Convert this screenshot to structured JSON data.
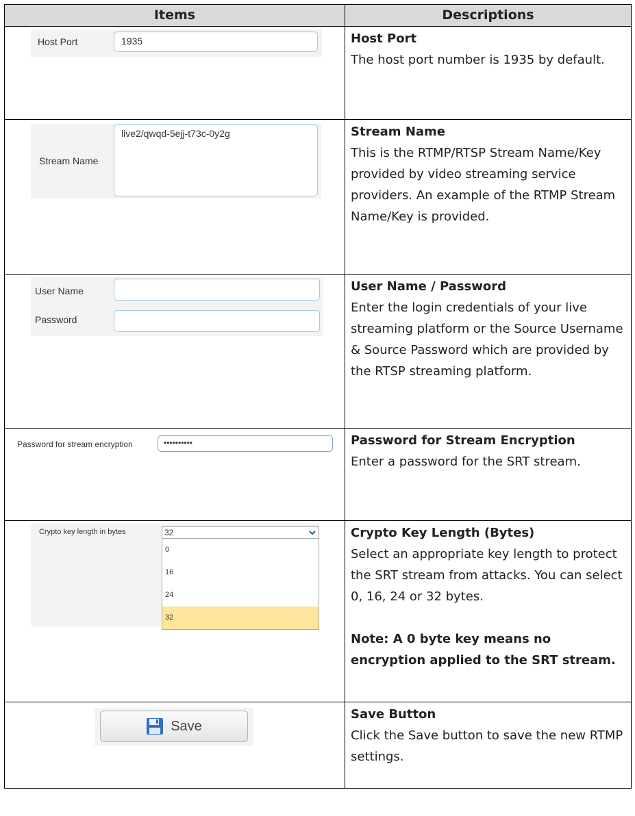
{
  "header": {
    "items": "Items",
    "descriptions": "Descriptions"
  },
  "rows": {
    "host_port": {
      "label": "Host Port",
      "value": "1935",
      "title": "Host Port",
      "desc": "The host port number is 1935 by default."
    },
    "stream_name": {
      "label": "Stream Name",
      "value": "live2/qwqd-5ejj-t73c-0y2g",
      "title": "Stream Name",
      "desc": "This is the RTMP/RTSP Stream Name/Key provided by video streaming service providers. An example of the RTMP Stream Name/Key is provided."
    },
    "credentials": {
      "user_label": "User Name",
      "user_value": "",
      "pass_label": "Password",
      "pass_value": "",
      "title": "User Name / Password",
      "desc": "Enter the login credentials of your live streaming platform or the Source Username & Source Password which are provided by the RTSP streaming platform."
    },
    "encryption": {
      "label": "Password for stream encryption",
      "value": "••••••••••",
      "title": "Password for Stream Encryption",
      "desc": "Enter a password for the SRT stream."
    },
    "crypto": {
      "label": "Crypto key length in bytes",
      "selected": "32",
      "options": [
        "0",
        "16",
        "24",
        "32"
      ],
      "title": "Crypto Key Length (Bytes)",
      "desc": "Select an appropriate key length to protect the SRT stream from attacks. You can select 0, 16, 24 or 32 bytes.",
      "note": "Note: A 0 byte key means no encryption applied to the SRT stream."
    },
    "save": {
      "label": "Save",
      "title": "Save Button",
      "desc": "Click the Save button to save the new RTMP settings."
    }
  },
  "colors": {
    "header_bg": "#d9d9d9",
    "selected_option": "#fde59b",
    "field_border": "#a9c6e0"
  },
  "icons": {
    "save": "floppy-disk-icon",
    "dropdown": "chevron-down-icon"
  }
}
